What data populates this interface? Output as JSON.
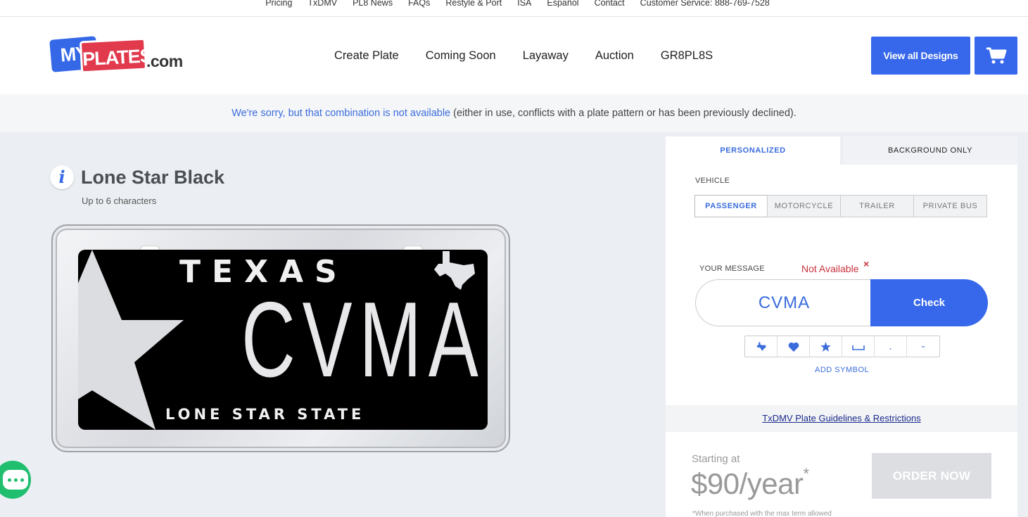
{
  "utility_nav": [
    "Pricing",
    "TxDMV",
    "PL8 News",
    "FAQs",
    "Restyle & Port",
    "ISA",
    "Español",
    "Contact",
    "Customer Service: 888-769-7528"
  ],
  "logo": {
    "my": "MY",
    "plates": "PLATES",
    "com": ".com"
  },
  "main_nav": [
    "Create Plate",
    "Coming Soon",
    "Layaway",
    "Auction",
    "GR8PL8S"
  ],
  "header_buttons": {
    "view_all": "View all Designs",
    "cart_icon": "cart-icon"
  },
  "notice": {
    "highlight": "We're sorry, but that combination is not available",
    "rest": " (either in use, conflicts with a plate pattern or has been previously declined)."
  },
  "product": {
    "info_icon": "i",
    "title": "Lone Star Black",
    "subtitle": "Up to 6 characters"
  },
  "plate": {
    "state": "TEXAS",
    "text": "CVMA",
    "slogan": "LONE STAR STATE"
  },
  "panel": {
    "tabs": [
      "PERSONALIZED",
      "BACKGROUND ONLY"
    ],
    "active_tab": "PERSONALIZED",
    "vehicle_label": "VEHICLE",
    "vehicles": [
      "PASSENGER",
      "MOTORCYCLE",
      "TRAILER",
      "PRIVATE BUS"
    ],
    "selected_vehicle": "PASSENGER",
    "message_label": "YOUR MESSAGE",
    "status": "Not Available",
    "status_mark": "×",
    "message_value": "CVMA",
    "check_label": "Check",
    "symbols": [
      "texas-icon",
      "heart-icon",
      "star-icon",
      "space-icon",
      ".",
      "-"
    ],
    "add_symbol": "ADD SYMBOL",
    "guidelines": "TxDMV Plate Guidelines & Restrictions",
    "starting_at": "Starting at",
    "price": "$90/year",
    "price_mark": "*",
    "fine_print": "*When purchased with the max term allowed",
    "order_now": "ORDER NOW"
  },
  "colors": {
    "brand_blue": "#3768eb",
    "brand_red": "#e13a4d",
    "error_red": "#c8323d",
    "chat_green": "#1fbf6f"
  }
}
